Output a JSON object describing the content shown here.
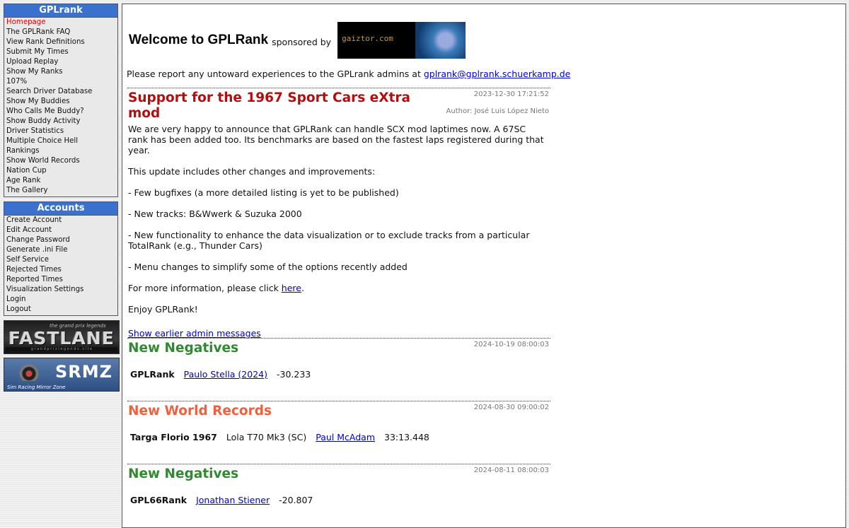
{
  "sidebar": {
    "main_title": "GPLrank",
    "main_items": [
      "Homepage",
      "The GPLRank FAQ",
      "View Rank Definitions",
      "Submit My Times",
      "Upload Replay",
      "Show My Ranks",
      "107%",
      "Search Driver Database",
      "Show My Buddies",
      "Who Calls Me Buddy?",
      "Show Buddy Activity",
      "Driver Statistics",
      "Multiple Choice Hell",
      "Rankings",
      "Show World Records",
      "Nation Cup",
      "Age Rank",
      "The Gallery"
    ],
    "accounts_title": "Accounts",
    "account_items": [
      "Create Account",
      "Edit Account",
      "Change Password",
      "Generate .ini File",
      "Self Service",
      "Rejected Times",
      "Reported Times",
      "Visualization Settings",
      "Login",
      "Logout"
    ],
    "banner1": {
      "big": "FASTLANE",
      "tiny": "the grand prix legends",
      "strip": "g r a n d p r i x l e g e n d s . s i t e"
    },
    "banner2": {
      "big": "SRMZ",
      "tiny": "Sim Racing Mirror Zone"
    }
  },
  "header": {
    "title": "Welcome to GPLRank",
    "sponsored": "sponsored by",
    "sponsor_logo": "gaiztor.com",
    "report_text": "Please report any untoward experiences to the GPLrank admins at ",
    "report_email": "gplrank@gplrank.schuerkamp.de"
  },
  "announcement": {
    "title": "Support for the 1967 Sport Cars eXtra mod",
    "date": "2023-12-30 17:21:52",
    "author": "Author: José Luis López Nieto",
    "p1": "We are very happy to announce that GPLRank can handle SCX mod laptimes now. A 67SC rank has been added too. Its benchmarks are based on the fastest laps registered during that year.",
    "p2": "This update includes other changes and improvements:",
    "p3": "- Few bugfixes (a more detailed listing is yet to be published)",
    "p4": "- New tracks: B&Wwerk & Suzuka 2000",
    "p5": "- New functionality to enhance the data visualization or to exclude tracks from a particular TotalRank (e.g., Thunder Cars)",
    "p6": "- Menu changes to simplify some of the options recently added",
    "p7_before": "For more information, please click ",
    "p7_link": "here",
    "p7_after": ".",
    "p8": "Enjoy GPLRank!",
    "earlier_link": "Show earlier admin messages"
  },
  "news1": {
    "title": "New Negatives",
    "date": "2024-10-19 08:00:03",
    "rank": "GPLRank",
    "driver": "Paulo Stella (2024)",
    "value": "-30.233"
  },
  "news2": {
    "title": "New World Records",
    "date": "2024-08-30 09:00:02",
    "track": "Targa Florio 1967",
    "car": "Lola T70 Mk3 (SC)",
    "driver": "Paul McAdam",
    "time": "33:13.448"
  },
  "news3": {
    "title": "New Negatives",
    "date": "2024-08-11 08:00:03",
    "rank": "GPL66Rank",
    "driver": "Jonathan Stiener",
    "value": "-20.807"
  },
  "colors": {
    "menu_header": "#3a71cf",
    "announcement_title": "#b50d0d",
    "negatives_title": "#2e8b2e",
    "records_title": "#f0603c"
  }
}
